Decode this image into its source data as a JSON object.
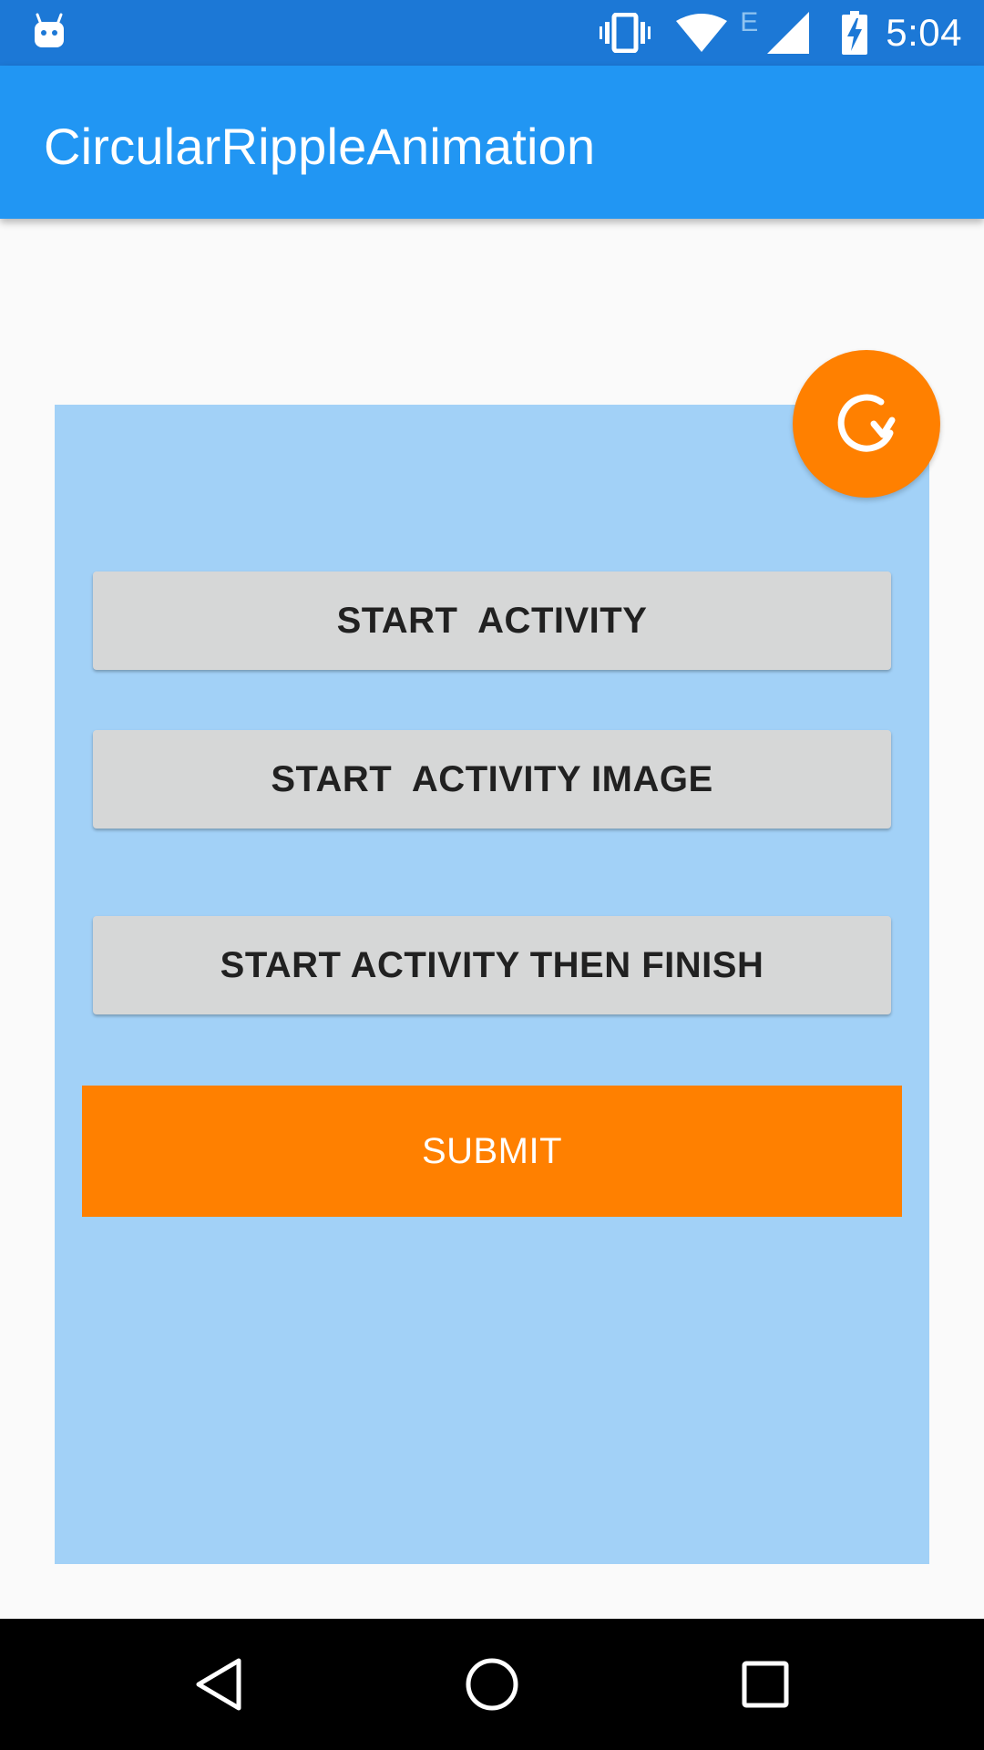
{
  "status_bar": {
    "time": "5:04",
    "network_type": "E",
    "icons": [
      "android-icon",
      "vibrate-icon",
      "wifi-icon",
      "network-type-icon",
      "cell-signal-icon",
      "battery-charging-icon"
    ]
  },
  "app_bar": {
    "title": "CircularRippleAnimation",
    "color": "#2196f3"
  },
  "content": {
    "panel_color": "#a2d1f7",
    "buttons": [
      {
        "label": "START  ACTIVITY"
      },
      {
        "label": "START  ACTIVITY IMAGE"
      },
      {
        "label": "START ACTIVITY THEN FINISH"
      }
    ],
    "submit": {
      "label": "SUBMIT",
      "color": "#ff8000"
    }
  },
  "fab": {
    "icon": "refresh-icon",
    "color": "#ff8000"
  },
  "nav_bar": {
    "buttons": [
      "back-icon",
      "home-icon",
      "recents-icon"
    ]
  }
}
